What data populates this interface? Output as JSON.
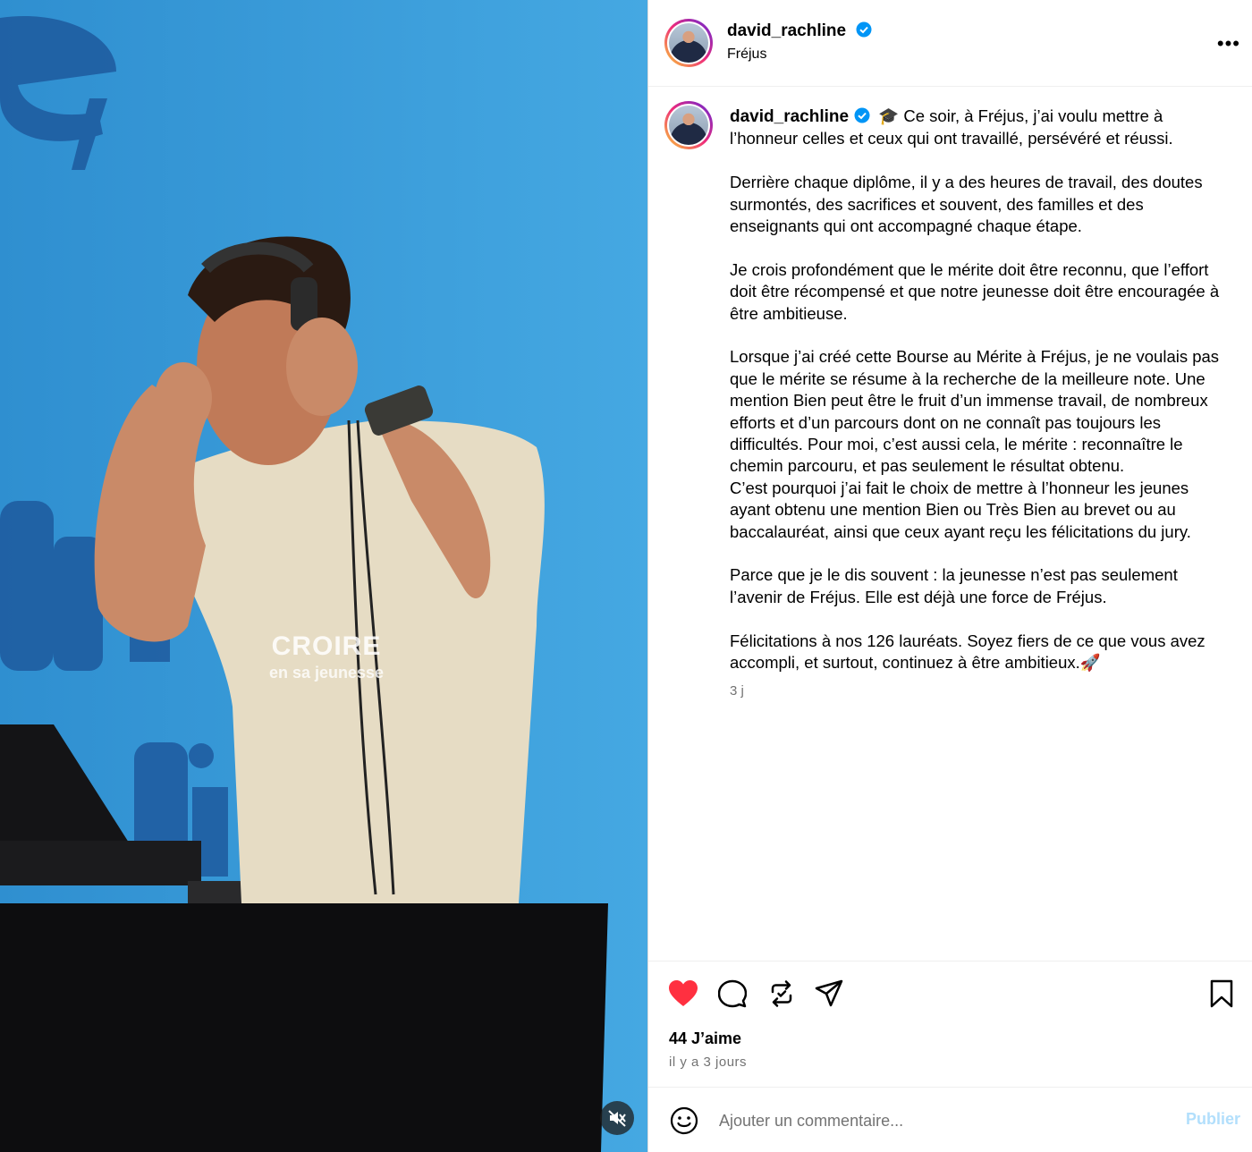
{
  "post": {
    "username": "david_rachline",
    "location": "Fréjus",
    "more_label": "•••"
  },
  "media": {
    "overlay_title": "CROIRE",
    "overlay_subtitle": "en sa jeunesse"
  },
  "caption": {
    "username": "david_rachline",
    "paragraphs": [
      "🎓 Ce soir, à Fréjus, j’ai voulu mettre à l’honneur celles et ceux qui ont travaillé, persévéré et réussi.",
      "Derrière chaque diplôme, il y a des heures de travail, des doutes surmontés, des sacrifices et souvent, des familles et des enseignants qui ont accompagné chaque étape.",
      "Je crois profondément que le mérite doit être reconnu, que l’effort doit être récompensé et que notre jeunesse doit être encouragée à être ambitieuse.",
      "Lorsque j’ai créé cette Bourse au Mérite à Fréjus, je ne voulais pas que le mérite se résume à la recherche de la meilleure note. Une mention Bien peut être le fruit d’un immense travail, de nombreux efforts et d’un parcours dont on ne connaît pas toujours les difficultés. Pour moi, c’est aussi cela, le mérite : reconnaître le chemin parcouru, et pas seulement le résultat obtenu.\nC’est pourquoi j’ai fait le choix de mettre à l’honneur les jeunes ayant obtenu une mention Bien ou Très Bien au brevet ou au baccalauréat, ainsi que ceux ayant reçu les félicitations du jury.",
      "Parce que je le dis souvent : la jeunesse n’est pas seulement l’avenir de Fréjus. Elle est déjà une force de Fréjus.",
      "Félicitations à nos 126 lauréats. Soyez fiers de ce que vous avez accompli, et surtout, continuez à être ambitieux.🚀"
    ],
    "time": "3 j"
  },
  "engagement": {
    "likes": "44 J’aime",
    "since": "il y a 3 jours"
  },
  "comment": {
    "placeholder": "Ajouter un commentaire...",
    "publish_label": "Publier"
  },
  "icons": {
    "like": "heart-filled-icon",
    "comment": "comment-bubble-icon",
    "repost": "repost-icon",
    "share": "paper-plane-icon",
    "save": "bookmark-icon",
    "emoji": "emoji-smile-icon",
    "mute": "speaker-muted-icon",
    "verified": "verified-badge-icon"
  },
  "colors": {
    "like_red": "#ff3040",
    "verified_blue": "#0095f6",
    "publish_disabled": "#b2dffc",
    "media_background": "#3a9bd8"
  }
}
